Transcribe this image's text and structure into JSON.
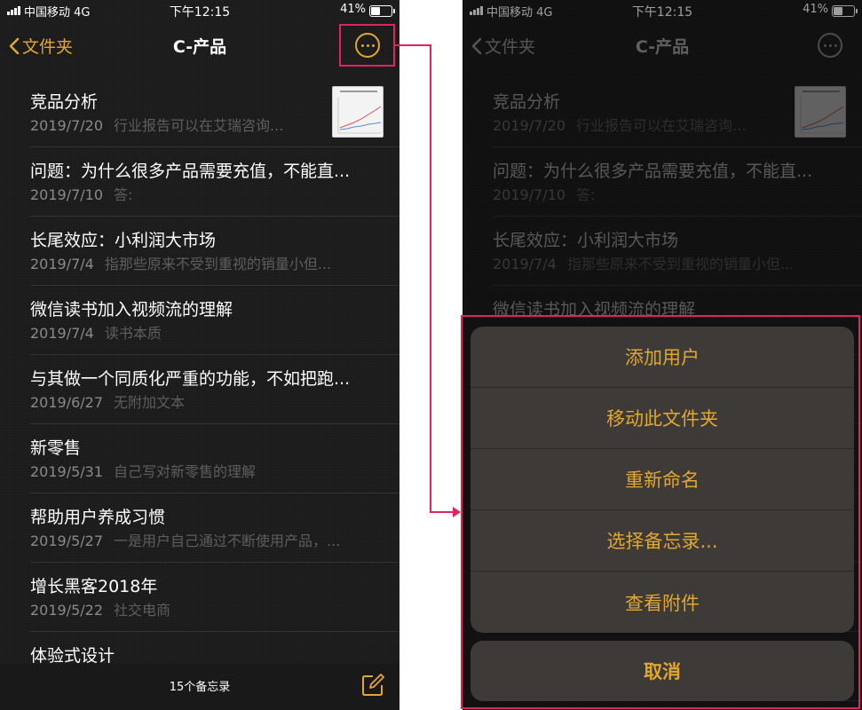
{
  "status_bar": {
    "carrier": "中国移动 4G",
    "time": "下午12:15",
    "battery": "41%",
    "battery_level": 0.41
  },
  "nav": {
    "back_label": "文件夹",
    "title": "C-产品"
  },
  "notes": [
    {
      "title": "竞品分析",
      "date": "2019/7/20",
      "preview": "行业报告可以在艾瑞咨询...",
      "has_thumbnail": true
    },
    {
      "title": "问题：为什么很多产品需要充值，不能直...",
      "date": "2019/7/10",
      "preview": "答:"
    },
    {
      "title": "长尾效应：小利润大市场",
      "date": "2019/7/4",
      "preview": "指那些原来不受到重视的销量小但..."
    },
    {
      "title": "微信读书加入视频流的理解",
      "date": "2019/7/4",
      "preview": "读书本质"
    },
    {
      "title": "与其做一个同质化严重的功能，不如把跑...",
      "date": "2019/6/27",
      "preview": "无附加文本"
    },
    {
      "title": "新零售",
      "date": "2019/5/31",
      "preview": "自己写对新零售的理解"
    },
    {
      "title": "帮助用户养成习惯",
      "date": "2019/5/27",
      "preview": "一是用户自己通过不断使用产品，..."
    },
    {
      "title": "增长黑客2018年",
      "date": "2019/5/22",
      "preview": "社交电商"
    },
    {
      "title": "体验式设计",
      "date": "",
      "preview": ""
    }
  ],
  "toolbar": {
    "note_count": "15个备忘录"
  },
  "action_sheet": {
    "items": [
      "添加用户",
      "移动此文件夹",
      "重新命名",
      "选择备忘录...",
      "查看附件"
    ],
    "cancel": "取消"
  },
  "colors": {
    "accent": "#e2a72e",
    "highlight": "#e0245e",
    "background": "#1b1b1b",
    "sheet": "#3d3a38"
  },
  "icons": [
    "signal-icon",
    "battery-icon",
    "chevron-left-icon",
    "more-icon",
    "compose-icon"
  ]
}
